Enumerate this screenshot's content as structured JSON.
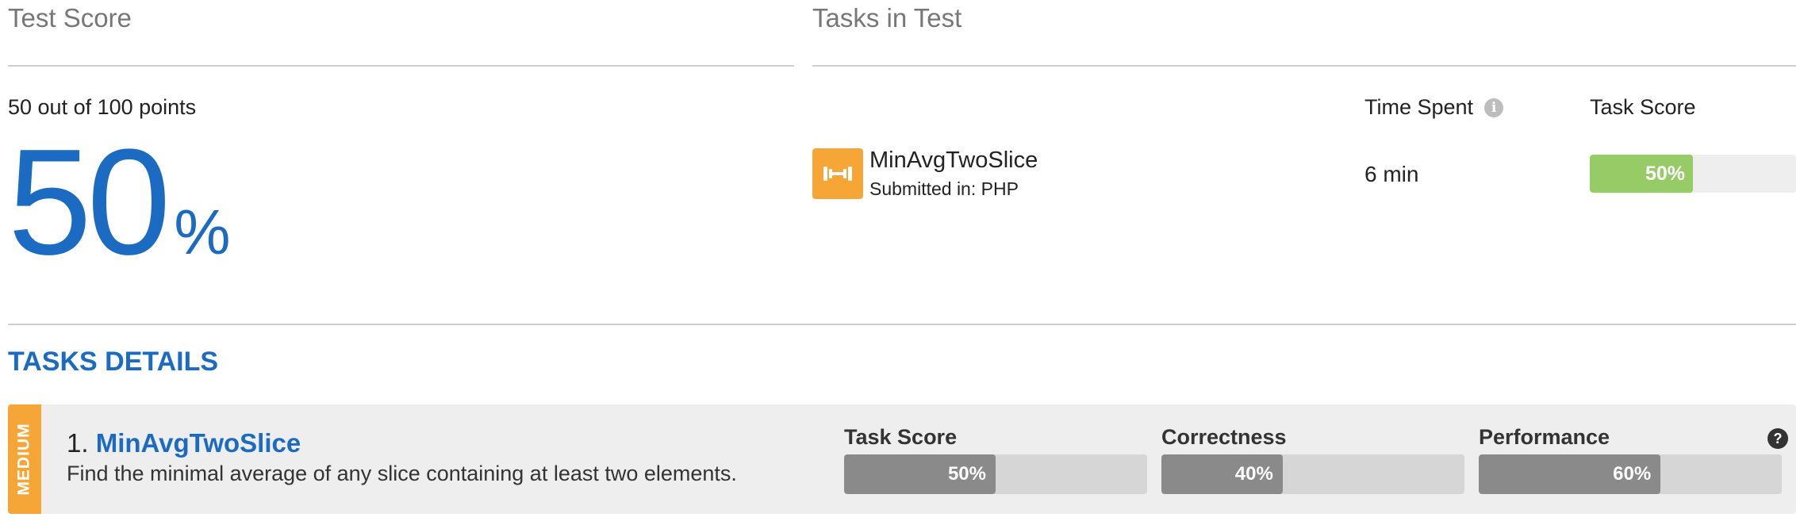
{
  "test_score": {
    "title": "Test Score",
    "points_text": "50 out of 100 points",
    "percent_value": "50",
    "percent_sign": "%"
  },
  "tasks_in_test": {
    "title": "Tasks in Test",
    "time_spent_label": "Time Spent",
    "task_score_label": "Task Score",
    "tasks": [
      {
        "name": "MinAvgTwoSlice",
        "submitted_text": "Submitted in: PHP",
        "time_spent": "6 min",
        "score_label": "50%",
        "score_fraction": 0.5,
        "icon": "dumbbell-icon"
      }
    ]
  },
  "tasks_details": {
    "title": "TASKS DETAILS",
    "items": [
      {
        "difficulty": "MEDIUM",
        "number": "1.",
        "name": "MinAvgTwoSlice",
        "description": "Find the minimal average of any slice containing at least two elements.",
        "metrics": [
          {
            "label": "Task Score",
            "value_label": "50%",
            "fraction": 0.5
          },
          {
            "label": "Correctness",
            "value_label": "40%",
            "fraction": 0.4
          },
          {
            "label": "Performance",
            "value_label": "60%",
            "fraction": 0.6
          }
        ],
        "help_icon": "question-icon"
      }
    ]
  },
  "colors": {
    "accent_blue": "#1b6bc2",
    "medium_orange": "#f6a637",
    "score_green": "#97cb66",
    "metric_gray": "#8a8a8a"
  }
}
